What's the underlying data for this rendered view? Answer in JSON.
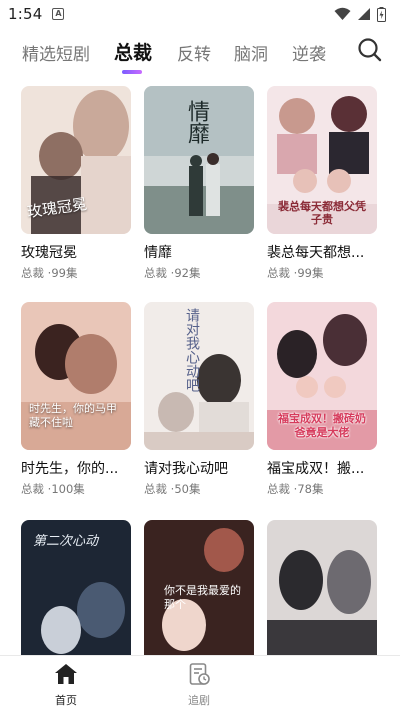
{
  "status_bar": {
    "time": "1:54",
    "notification_icon_letter": "A"
  },
  "tabs": [
    {
      "label": "精选短剧",
      "active": false
    },
    {
      "label": "总裁",
      "active": true
    },
    {
      "label": "反转",
      "active": false
    },
    {
      "label": "脑洞",
      "active": false
    },
    {
      "label": "逆袭",
      "active": false
    }
  ],
  "dramas": [
    {
      "title": "玫瑰冠冕",
      "genre": "总裁",
      "episodes": "99集",
      "poster_text": "玫瑰冠冕",
      "colors": [
        "#efe3db",
        "#c9a99a",
        "#3a2d2b"
      ]
    },
    {
      "title": "情靡",
      "genre": "总裁",
      "episodes": "92集",
      "poster_text": "情靡",
      "colors": [
        "#cfd6d6",
        "#7f8f8a",
        "#2f3a38"
      ]
    },
    {
      "title": "裴总每天都想...",
      "genre": "总裁",
      "episodes": "99集",
      "poster_text": "裴总每天都想父凭子贵",
      "colors": [
        "#f4e6e8",
        "#d9a7ae",
        "#5a3036"
      ]
    },
    {
      "title": "时先生，你的...",
      "genre": "总裁",
      "episodes": "100集",
      "poster_text": "时先生，你的马甲藏不住啦",
      "colors": [
        "#e9c6b8",
        "#b07d6c",
        "#3b2320"
      ]
    },
    {
      "title": "请对我心动吧",
      "genre": "总裁",
      "episodes": "50集",
      "poster_text": "请对我心动吧",
      "colors": [
        "#f1ece9",
        "#c8b9b2",
        "#3a3432"
      ]
    },
    {
      "title": "福宝成双！搬...",
      "genre": "总裁",
      "episodes": "78集",
      "poster_text": "福宝成双！搬砖奶爸竟是大佬",
      "colors": [
        "#f3d8dc",
        "#e39aa6",
        "#4a2f36"
      ]
    },
    {
      "title": "",
      "genre": "",
      "episodes": "",
      "poster_text": "第二次心动",
      "colors": [
        "#1d2634",
        "#4a5a72",
        "#c9cfd8"
      ]
    },
    {
      "title": "",
      "genre": "",
      "episodes": "",
      "poster_text": "你不是我最爱的那个",
      "colors": [
        "#3a2320",
        "#a2584b",
        "#efd6cc"
      ]
    },
    {
      "title": "",
      "genre": "",
      "episodes": "",
      "poster_text": "",
      "colors": [
        "#2b2a2e",
        "#6d6a70",
        "#dcd7d6"
      ]
    }
  ],
  "meta_separator": "·",
  "bottom_nav": [
    {
      "label": "首页",
      "active": true,
      "icon": "home-icon"
    },
    {
      "label": "追剧",
      "active": false,
      "icon": "watchlist-icon"
    }
  ]
}
